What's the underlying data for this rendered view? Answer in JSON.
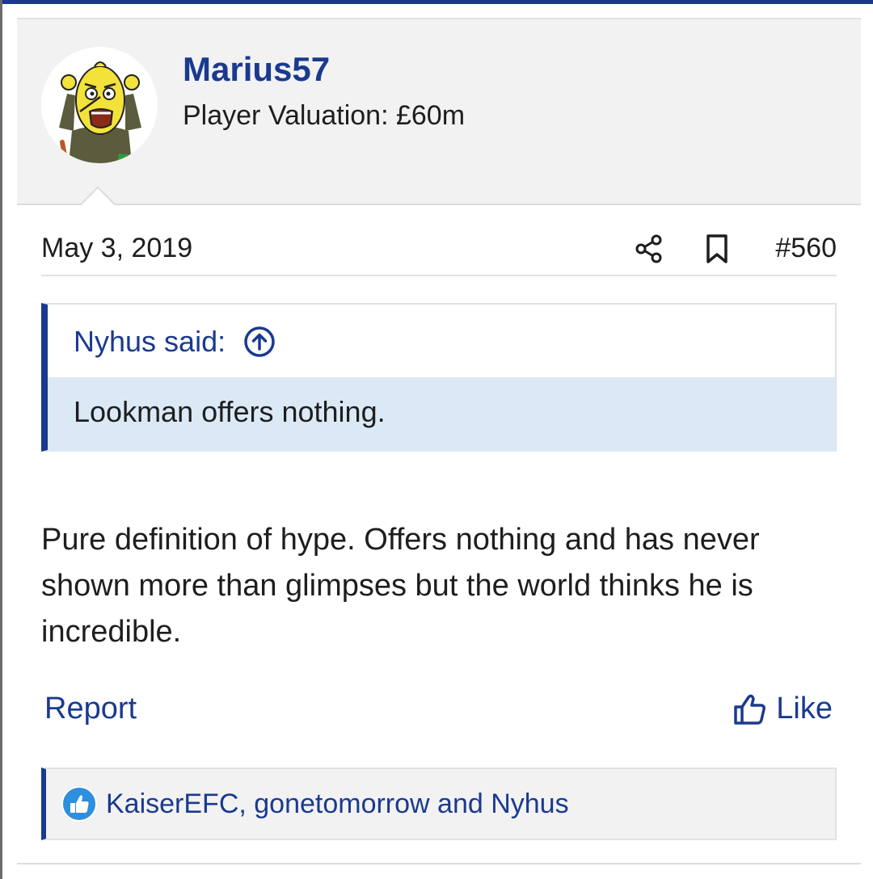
{
  "post": {
    "author": {
      "username": "Marius57",
      "title": "Player Valuation: £60m",
      "avatar_icon": "lemon-cartoon-avatar"
    },
    "date": "May 3, 2019",
    "number": "#560",
    "actions": {
      "share_icon": "share-icon",
      "bookmark_icon": "bookmark-icon"
    },
    "quote": {
      "author_label": "Nyhus said:",
      "jump_icon": "arrow-up-circle-icon",
      "text": "Lookman offers nothing."
    },
    "message": "Pure definition of hype. Offers nothing and has never shown more than glimpses but the world thinks he is incredible.",
    "footer": {
      "report_label": "Report",
      "like_label": "Like",
      "like_icon": "thumbs-up-icon"
    },
    "reactions": {
      "badge_icon": "like-reaction-icon",
      "users_text": "KaiserEFC, gonetomorrow and Nyhus"
    }
  },
  "colors": {
    "accent": "#1a3a8f",
    "quote_background": "#dbe9f7",
    "header_background": "#f2f2f2",
    "text": "#1e1e1e",
    "reaction_badge": "#2d8fdd"
  }
}
